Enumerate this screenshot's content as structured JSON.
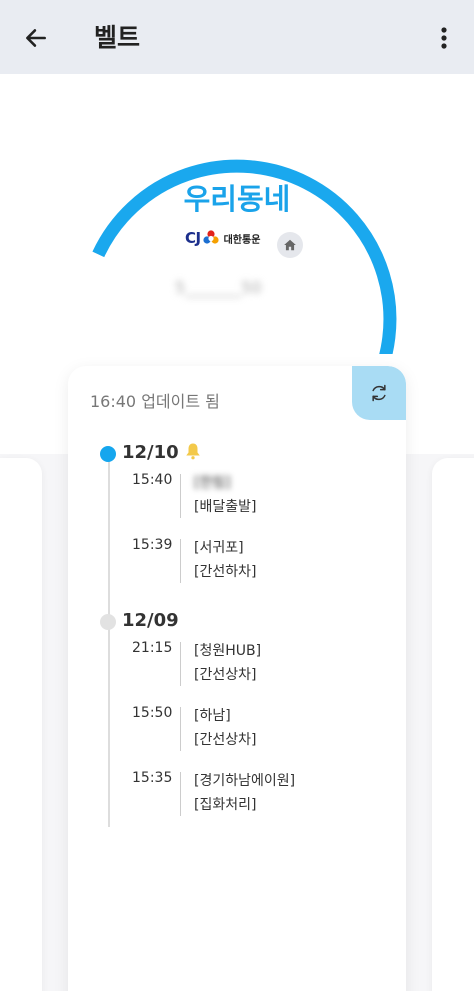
{
  "header": {
    "title": "벨트"
  },
  "shop": {
    "name": "우리동네",
    "tracking_number": "5_______50"
  },
  "carrier": {
    "logo_text": "CJ",
    "name": "대한통운"
  },
  "gauge": {
    "progress": 0.8,
    "active_color": "#1aa8ee",
    "track_color": "#d5d5d5"
  },
  "tracking": {
    "updated": "16:40 업데이트 됨",
    "groups": [
      {
        "date": "12/10",
        "active": true,
        "events": [
          {
            "time": "15:40",
            "location": "[한림]",
            "status": "[배달출발]"
          },
          {
            "time": "15:39",
            "location": "[서귀포]",
            "status": "[간선하차]"
          }
        ]
      },
      {
        "date": "12/09",
        "active": false,
        "events": [
          {
            "time": "21:15",
            "location": "[청원HUB]",
            "status": "[간선상차]"
          },
          {
            "time": "15:50",
            "location": "[하남]",
            "status": "[간선상차]"
          },
          {
            "time": "15:35",
            "location": "[경기하남에이원]",
            "status": "[집화처리]"
          }
        ]
      }
    ]
  }
}
